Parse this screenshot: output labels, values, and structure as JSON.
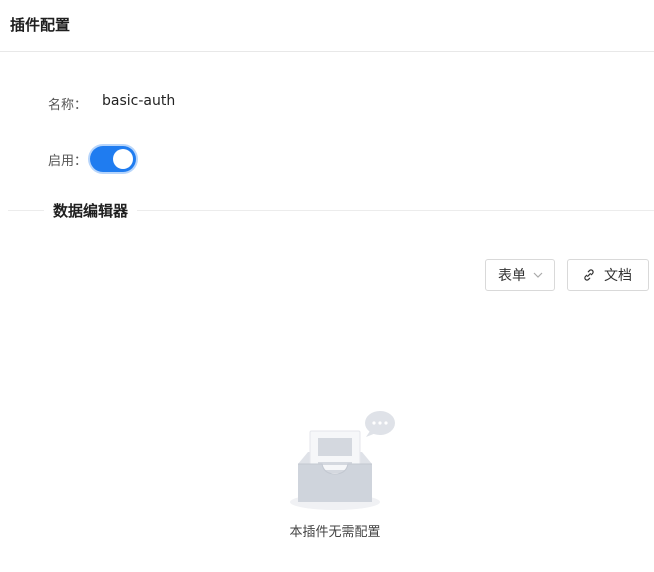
{
  "header": {
    "title": "插件配置"
  },
  "form": {
    "name_label": "名称：",
    "name_value": "basic-auth",
    "enabled_label": "启用：",
    "enabled": true
  },
  "section": {
    "title": "数据编辑器"
  },
  "toolbar": {
    "mode_select": "表单",
    "doc_button": "文档"
  },
  "empty": {
    "text": "本插件无需配置"
  },
  "colors": {
    "accent": "#1f7cf0",
    "divider": "#ececec"
  },
  "icons": [
    "chevron-down-icon",
    "link-icon",
    "empty-inbox-icon",
    "chat-bubble-icon"
  ]
}
